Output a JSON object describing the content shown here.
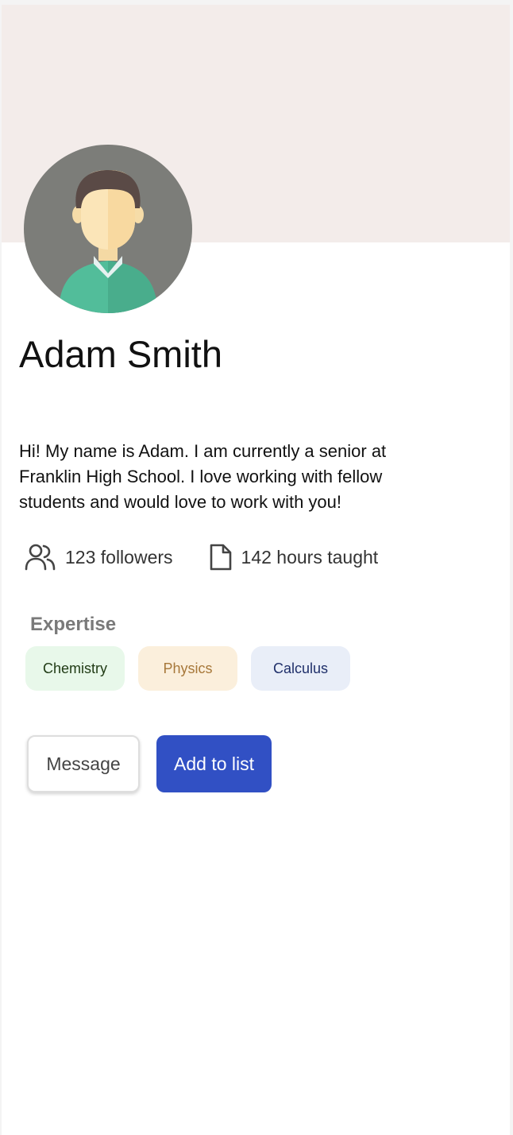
{
  "profile": {
    "name": "Adam Smith",
    "bio": "Hi! My name is Adam. I am currently a senior at Franklin High School. I love working with fellow students and would love to work with you!",
    "avatar_icon": "person-avatar-icon"
  },
  "stats": {
    "followers_icon": "users-icon",
    "followers": "123 followers",
    "hours_icon": "document-icon",
    "hours": "142 hours taught"
  },
  "expertise": {
    "title": "Expertise",
    "tags": [
      "Chemistry",
      "Physics",
      "Calculus"
    ]
  },
  "actions": {
    "message_label": "Message",
    "add_label": "Add to list"
  },
  "colors": {
    "banner": "#f3ecea",
    "primary": "#3150c4",
    "chemistry_bg": "#e8f8ea",
    "physics_bg": "#fbefdc",
    "calculus_bg": "#e9eef8"
  }
}
